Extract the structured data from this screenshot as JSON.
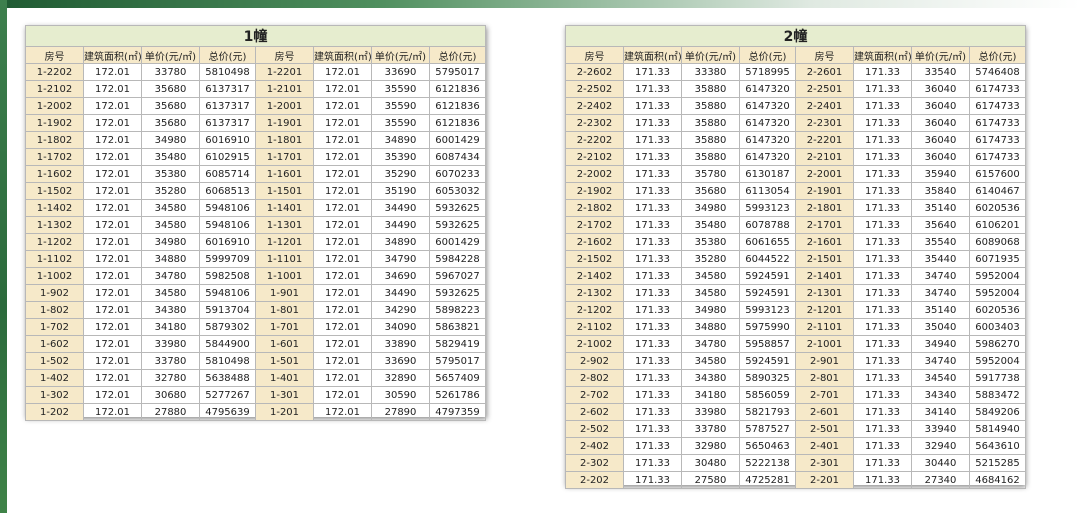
{
  "headers": [
    "房号",
    "建筑面积(㎡)",
    "单价(元/㎡)",
    "总价(元)"
  ],
  "buildings": [
    {
      "title": "1幢",
      "rows": [
        [
          [
            "1-2202",
            "172.01",
            "33780",
            "5810498"
          ],
          [
            "1-2201",
            "172.01",
            "33690",
            "5795017"
          ]
        ],
        [
          [
            "1-2102",
            "172.01",
            "35680",
            "6137317"
          ],
          [
            "1-2101",
            "172.01",
            "35590",
            "6121836"
          ]
        ],
        [
          [
            "1-2002",
            "172.01",
            "35680",
            "6137317"
          ],
          [
            "1-2001",
            "172.01",
            "35590",
            "6121836"
          ]
        ],
        [
          [
            "1-1902",
            "172.01",
            "35680",
            "6137317"
          ],
          [
            "1-1901",
            "172.01",
            "35590",
            "6121836"
          ]
        ],
        [
          [
            "1-1802",
            "172.01",
            "34980",
            "6016910"
          ],
          [
            "1-1801",
            "172.01",
            "34890",
            "6001429"
          ]
        ],
        [
          [
            "1-1702",
            "172.01",
            "35480",
            "6102915"
          ],
          [
            "1-1701",
            "172.01",
            "35390",
            "6087434"
          ]
        ],
        [
          [
            "1-1602",
            "172.01",
            "35380",
            "6085714"
          ],
          [
            "1-1601",
            "172.01",
            "35290",
            "6070233"
          ]
        ],
        [
          [
            "1-1502",
            "172.01",
            "35280",
            "6068513"
          ],
          [
            "1-1501",
            "172.01",
            "35190",
            "6053032"
          ]
        ],
        [
          [
            "1-1402",
            "172.01",
            "34580",
            "5948106"
          ],
          [
            "1-1401",
            "172.01",
            "34490",
            "5932625"
          ]
        ],
        [
          [
            "1-1302",
            "172.01",
            "34580",
            "5948106"
          ],
          [
            "1-1301",
            "172.01",
            "34490",
            "5932625"
          ]
        ],
        [
          [
            "1-1202",
            "172.01",
            "34980",
            "6016910"
          ],
          [
            "1-1201",
            "172.01",
            "34890",
            "6001429"
          ]
        ],
        [
          [
            "1-1102",
            "172.01",
            "34880",
            "5999709"
          ],
          [
            "1-1101",
            "172.01",
            "34790",
            "5984228"
          ]
        ],
        [
          [
            "1-1002",
            "172.01",
            "34780",
            "5982508"
          ],
          [
            "1-1001",
            "172.01",
            "34690",
            "5967027"
          ]
        ],
        [
          [
            "1-902",
            "172.01",
            "34580",
            "5948106"
          ],
          [
            "1-901",
            "172.01",
            "34490",
            "5932625"
          ]
        ],
        [
          [
            "1-802",
            "172.01",
            "34380",
            "5913704"
          ],
          [
            "1-801",
            "172.01",
            "34290",
            "5898223"
          ]
        ],
        [
          [
            "1-702",
            "172.01",
            "34180",
            "5879302"
          ],
          [
            "1-701",
            "172.01",
            "34090",
            "5863821"
          ]
        ],
        [
          [
            "1-602",
            "172.01",
            "33980",
            "5844900"
          ],
          [
            "1-601",
            "172.01",
            "33890",
            "5829419"
          ]
        ],
        [
          [
            "1-502",
            "172.01",
            "33780",
            "5810498"
          ],
          [
            "1-501",
            "172.01",
            "33690",
            "5795017"
          ]
        ],
        [
          [
            "1-402",
            "172.01",
            "32780",
            "5638488"
          ],
          [
            "1-401",
            "172.01",
            "32890",
            "5657409"
          ]
        ],
        [
          [
            "1-302",
            "172.01",
            "30680",
            "5277267"
          ],
          [
            "1-301",
            "172.01",
            "30590",
            "5261786"
          ]
        ],
        [
          [
            "1-202",
            "172.01",
            "27880",
            "4795639"
          ],
          [
            "1-201",
            "172.01",
            "27890",
            "4797359"
          ]
        ]
      ]
    },
    {
      "title": "2幢",
      "rows": [
        [
          [
            "2-2602",
            "171.33",
            "33380",
            "5718995"
          ],
          [
            "2-2601",
            "171.33",
            "33540",
            "5746408"
          ]
        ],
        [
          [
            "2-2502",
            "171.33",
            "35880",
            "6147320"
          ],
          [
            "2-2501",
            "171.33",
            "36040",
            "6174733"
          ]
        ],
        [
          [
            "2-2402",
            "171.33",
            "35880",
            "6147320"
          ],
          [
            "2-2401",
            "171.33",
            "36040",
            "6174733"
          ]
        ],
        [
          [
            "2-2302",
            "171.33",
            "35880",
            "6147320"
          ],
          [
            "2-2301",
            "171.33",
            "36040",
            "6174733"
          ]
        ],
        [
          [
            "2-2202",
            "171.33",
            "35880",
            "6147320"
          ],
          [
            "2-2201",
            "171.33",
            "36040",
            "6174733"
          ]
        ],
        [
          [
            "2-2102",
            "171.33",
            "35880",
            "6147320"
          ],
          [
            "2-2101",
            "171.33",
            "36040",
            "6174733"
          ]
        ],
        [
          [
            "2-2002",
            "171.33",
            "35780",
            "6130187"
          ],
          [
            "2-2001",
            "171.33",
            "35940",
            "6157600"
          ]
        ],
        [
          [
            "2-1902",
            "171.33",
            "35680",
            "6113054"
          ],
          [
            "2-1901",
            "171.33",
            "35840",
            "6140467"
          ]
        ],
        [
          [
            "2-1802",
            "171.33",
            "34980",
            "5993123"
          ],
          [
            "2-1801",
            "171.33",
            "35140",
            "6020536"
          ]
        ],
        [
          [
            "2-1702",
            "171.33",
            "35480",
            "6078788"
          ],
          [
            "2-1701",
            "171.33",
            "35640",
            "6106201"
          ]
        ],
        [
          [
            "2-1602",
            "171.33",
            "35380",
            "6061655"
          ],
          [
            "2-1601",
            "171.33",
            "35540",
            "6089068"
          ]
        ],
        [
          [
            "2-1502",
            "171.33",
            "35280",
            "6044522"
          ],
          [
            "2-1501",
            "171.33",
            "35440",
            "6071935"
          ]
        ],
        [
          [
            "2-1402",
            "171.33",
            "34580",
            "5924591"
          ],
          [
            "2-1401",
            "171.33",
            "34740",
            "5952004"
          ]
        ],
        [
          [
            "2-1302",
            "171.33",
            "34580",
            "5924591"
          ],
          [
            "2-1301",
            "171.33",
            "34740",
            "5952004"
          ]
        ],
        [
          [
            "2-1202",
            "171.33",
            "34980",
            "5993123"
          ],
          [
            "2-1201",
            "171.33",
            "35140",
            "6020536"
          ]
        ],
        [
          [
            "2-1102",
            "171.33",
            "34880",
            "5975990"
          ],
          [
            "2-1101",
            "171.33",
            "35040",
            "6003403"
          ]
        ],
        [
          [
            "2-1002",
            "171.33",
            "34780",
            "5958857"
          ],
          [
            "2-1001",
            "171.33",
            "34940",
            "5986270"
          ]
        ],
        [
          [
            "2-902",
            "171.33",
            "34580",
            "5924591"
          ],
          [
            "2-901",
            "171.33",
            "34740",
            "5952004"
          ]
        ],
        [
          [
            "2-802",
            "171.33",
            "34380",
            "5890325"
          ],
          [
            "2-801",
            "171.33",
            "34540",
            "5917738"
          ]
        ],
        [
          [
            "2-702",
            "171.33",
            "34180",
            "5856059"
          ],
          [
            "2-701",
            "171.33",
            "34340",
            "5883472"
          ]
        ],
        [
          [
            "2-602",
            "171.33",
            "33980",
            "5821793"
          ],
          [
            "2-601",
            "171.33",
            "34140",
            "5849206"
          ]
        ],
        [
          [
            "2-502",
            "171.33",
            "33780",
            "5787527"
          ],
          [
            "2-501",
            "171.33",
            "33940",
            "5814940"
          ]
        ],
        [
          [
            "2-402",
            "171.33",
            "32980",
            "5650463"
          ],
          [
            "2-401",
            "171.33",
            "32940",
            "5643610"
          ]
        ],
        [
          [
            "2-302",
            "171.33",
            "30480",
            "5222138"
          ],
          [
            "2-301",
            "171.33",
            "30440",
            "5215285"
          ]
        ],
        [
          [
            "2-202",
            "171.33",
            "27580",
            "4725281"
          ],
          [
            "2-201",
            "171.33",
            "27340",
            "4684162"
          ]
        ]
      ]
    }
  ]
}
